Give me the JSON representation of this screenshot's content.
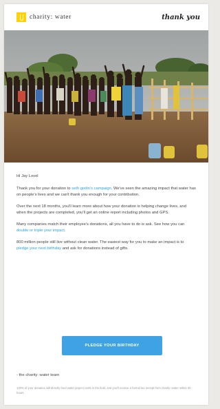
{
  "header": {
    "brand_name": "charity: water",
    "thank_you": "thank you"
  },
  "photo": {
    "icon": "crowd-celebrating-water-point-image"
  },
  "body": {
    "greeting": "Hi Jay Lovel",
    "p1_before": "Thank you for your donation to ",
    "p1_link": "seth godin's campaign",
    "p1_after": ". We've seen the amazing impact that water has on people's lives and we can't thank you enough for your contribution.",
    "p2": "Over the next 18 months, you'll learn more about how your donation is helping change lives, and when the projects are completed, you'll get an online report including photos and GPS.",
    "p3_before": "Many companies match their employee's donations, all you have to do is ask. See how you can ",
    "p3_link": "double or triple your impact",
    "p3_after": ".",
    "p4_before": "800 million people still live without clean water. The easiest way for you to make an impact is to ",
    "p4_link": "pledge your next birthday",
    "p4_after": " and ask for donations instead of gifts."
  },
  "cta": {
    "label": "PLEDGE YOUR BIRTHDAY"
  },
  "footer": {
    "signoff": "- the charity: water team",
    "fineprint": "100% of your donation will directly fund water project costs in the field, and you'll receive a formal tax receipt from charity: water within 30 hours."
  },
  "colors": {
    "accent": "#3ea2e3",
    "link": "#2aa3e0",
    "brand_yellow": "#ffd200",
    "page_bg": "#eceae6"
  }
}
